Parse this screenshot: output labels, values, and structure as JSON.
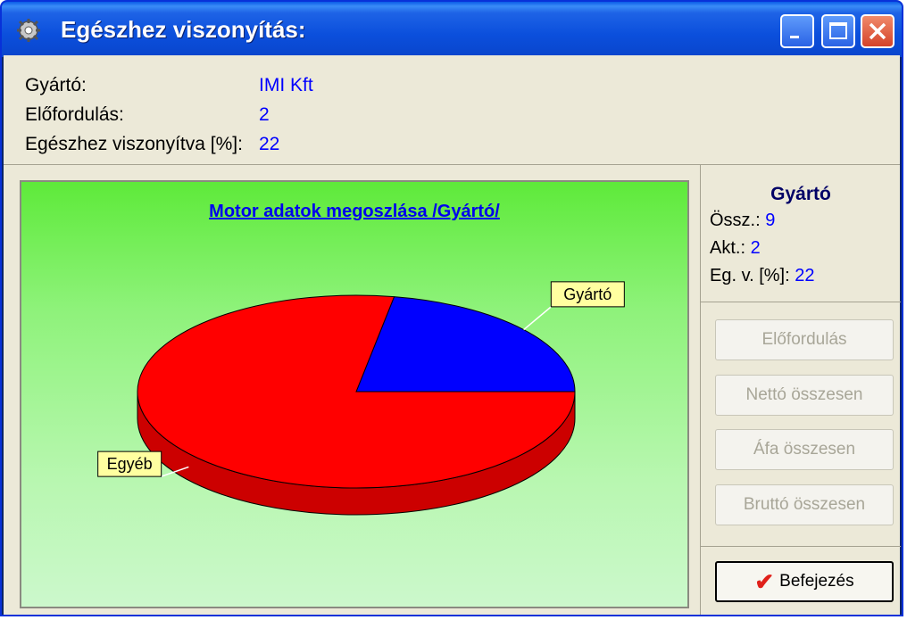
{
  "window": {
    "title": "Egészhez viszonyítás:"
  },
  "info": [
    {
      "label": "Gyártó:",
      "value": "IMI Kft"
    },
    {
      "label": "Előfordulás:",
      "value": "2"
    },
    {
      "label": "Egészhez viszonyítva [%]:",
      "value": "22"
    }
  ],
  "side": {
    "heading": "Gyártó",
    "stats": [
      {
        "label": "Össz.:",
        "value": "9"
      },
      {
        "label": "Akt.:",
        "value": "2"
      },
      {
        "label": "Eg. v. [%]:",
        "value": "22"
      }
    ],
    "buttons": [
      "Előfordulás",
      "Nettó összesen",
      "Áfa összesen",
      "Bruttó összesen"
    ],
    "finish": "Befejezés"
  },
  "chart_data": {
    "type": "pie",
    "title": "Motor adatok megoszlása /Gyártó/",
    "slices": [
      {
        "label": "Gyártó",
        "value": 2,
        "color": "#0000ff"
      },
      {
        "label": "Egyéb",
        "value": 7,
        "color": "#ff0000"
      }
    ]
  }
}
